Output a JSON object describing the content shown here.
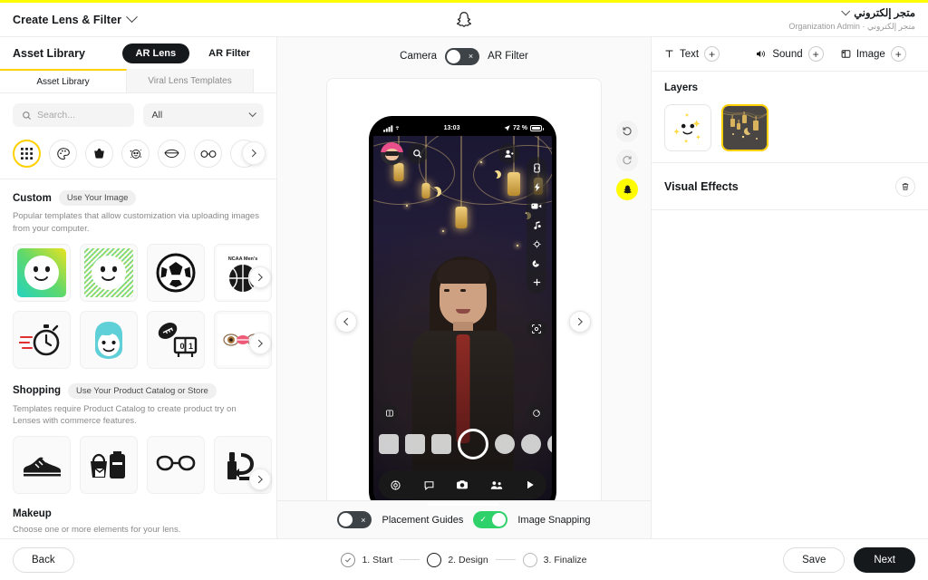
{
  "topbar": {
    "title": "Create Lens & Filter",
    "logo_icon": "snapchat-ghost-icon",
    "chevron_icon": "chevron-down-icon",
    "org_name": "متجر إلكتروني",
    "org_sub": "Organization Admin · متجر إلكتروني"
  },
  "left_panel": {
    "title": "Asset Library",
    "segments": [
      {
        "label": "AR Lens",
        "active": true
      },
      {
        "label": "AR Filter",
        "active": false
      }
    ],
    "tabs": [
      {
        "label": "Asset Library",
        "active": true
      },
      {
        "label": "Viral Lens Templates",
        "active": false
      }
    ],
    "search": {
      "placeholder": "Search...",
      "value": "",
      "icon": "search-icon"
    },
    "filter_select": {
      "value": "All",
      "icon": "chevron-down-icon"
    },
    "categories": [
      {
        "name": "grid-icon",
        "active": true
      },
      {
        "name": "palette-icon",
        "active": false
      },
      {
        "name": "basket-icon",
        "active": false
      },
      {
        "name": "face-sparkle-icon",
        "active": false
      },
      {
        "name": "lips-icon",
        "active": false
      },
      {
        "name": "glasses-icon",
        "active": false
      },
      {
        "name": "chevron-left-icon",
        "active": false
      }
    ],
    "category_next_icon": "chevron-right-icon",
    "sections": [
      {
        "title": "Custom",
        "pill": "Use Your Image",
        "description": "Popular templates that allow customization via uploading images from your computer.",
        "tiles": [
          "smiley-gradient-template",
          "smiley-stripes-template",
          "soccer-ball-template",
          "ncaa-basketball-template",
          "stopwatch-template",
          "teal-hair-avatar-template",
          "football-scoreboard-template",
          "eyes-lips-template"
        ],
        "next_icon": "chevron-right-icon"
      },
      {
        "title": "Shopping",
        "pill": "Use Your Product Catalog or Store",
        "description": "Templates require Product Catalog to create product try on Lenses with commerce features.",
        "tiles": [
          "sneaker-template",
          "luggage-bags-template",
          "eyeglasses-template",
          "lipstick-template"
        ],
        "next_icon": "chevron-right-icon"
      },
      {
        "title": "Makeup",
        "pill": "",
        "description": "Choose one or more elements for your lens.",
        "tiles": [],
        "next_icon": ""
      }
    ]
  },
  "preview": {
    "mode_toggle": {
      "left_label": "Camera",
      "right_label": "AR Filter",
      "state": "off",
      "marker": "×"
    },
    "phone": {
      "status_time": "13:03",
      "status_battery": "72 %",
      "status_signal_icon": "signal-bars-icon",
      "status_wifi_icon": "wifi-icon",
      "status_location_icon": "location-arrow-icon",
      "top_icons": [
        "bitmoji-avatar-icon",
        "search-icon",
        "add-friends-icon",
        "flip-camera-icon"
      ],
      "rail_icons": [
        "flash-icon",
        "video-icon",
        "music-icon",
        "timer-icon",
        "night-mode-icon",
        "plus-icon"
      ],
      "rail_solo_icon": "scan-settings-icon",
      "carousel_items": [
        "lens-square",
        "lens-square",
        "lens-square",
        "shutter-button",
        "lens-circle",
        "lens-circle",
        "lens-circle"
      ],
      "side_left_icon": "memories-icon",
      "side_right_icon": "send-icon",
      "nav_icons": [
        "map-icon",
        "chat-icon",
        "camera-icon",
        "friends-icon",
        "spotlight-icon"
      ]
    },
    "side_controls": [
      {
        "name": "undo-button",
        "icon": "undo-icon"
      },
      {
        "name": "redo-button",
        "icon": "redo-icon"
      },
      {
        "name": "snapchat-button",
        "icon": "snapchat-ghost-icon"
      }
    ],
    "prev_icon": "chevron-left-icon",
    "next_icon": "chevron-right-icon",
    "bottom_toggles": [
      {
        "label": "Placement Guides",
        "state": "off",
        "marker": "×"
      },
      {
        "label": "Image Snapping",
        "state": "on",
        "marker": "✓"
      }
    ]
  },
  "right_panel": {
    "add_items": [
      {
        "label": "Text",
        "icon": "text-icon",
        "add_icon": "plus-icon"
      },
      {
        "label": "Sound",
        "icon": "sound-icon",
        "add_icon": "plus-icon"
      },
      {
        "label": "Image",
        "icon": "image-icon",
        "add_icon": "plus-icon"
      }
    ],
    "layers_title": "Layers",
    "layers": [
      {
        "name": "sparkle-smiley-layer",
        "selected": false
      },
      {
        "name": "lanterns-background-layer",
        "selected": true
      }
    ],
    "visual_effects_title": "Visual Effects",
    "visual_effects_delete_icon": "trash-icon"
  },
  "footer": {
    "back_label": "Back",
    "save_label": "Save",
    "next_label": "Next",
    "steps": [
      {
        "label": "1. Start",
        "state": "done",
        "icon": "check-icon"
      },
      {
        "label": "2. Design",
        "state": "current",
        "icon": ""
      },
      {
        "label": "3. Finalize",
        "state": "todo",
        "icon": ""
      }
    ]
  },
  "colors": {
    "brand_yellow": "#FFFC00",
    "accent_yellow": "#FFD100",
    "dark": "#16191C",
    "green_on": "#2FD16A"
  }
}
